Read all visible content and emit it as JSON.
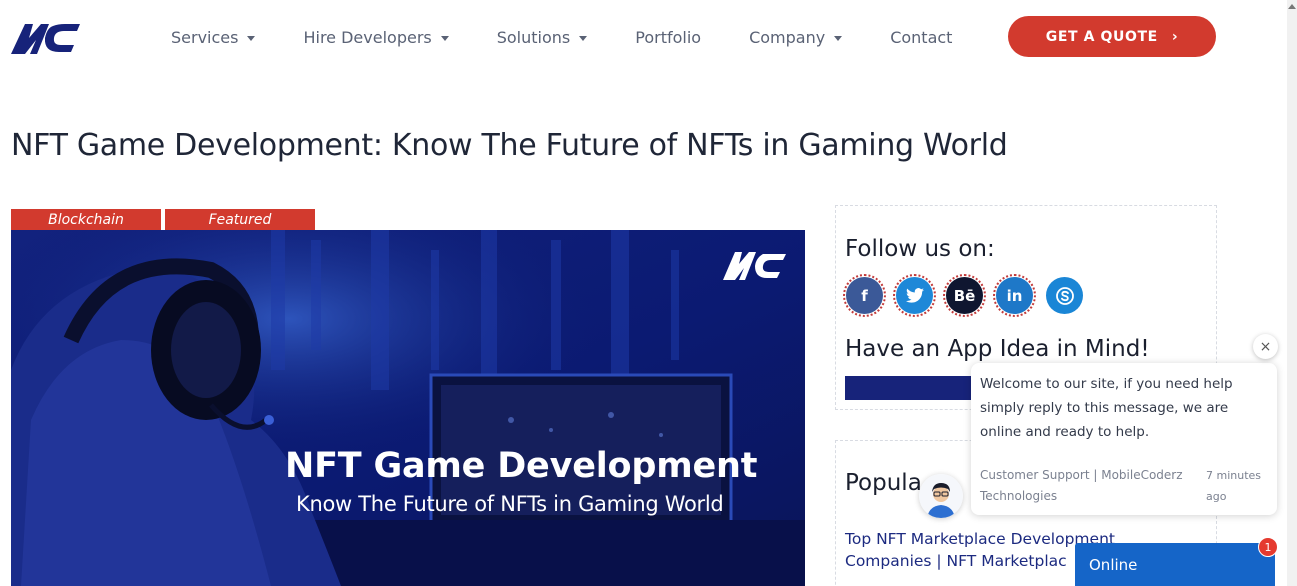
{
  "header": {
    "logo_text": "MC",
    "nav": [
      {
        "label": "Services",
        "dropdown": true
      },
      {
        "label": "Hire Developers",
        "dropdown": true
      },
      {
        "label": "Solutions",
        "dropdown": true
      },
      {
        "label": "Portfolio",
        "dropdown": false
      },
      {
        "label": "Company",
        "dropdown": true
      },
      {
        "label": "Contact",
        "dropdown": false
      }
    ],
    "cta_label": "GET A QUOTE",
    "cta_icon": "chevron-right-icon"
  },
  "article": {
    "title": "NFT Game Development: Know The Future of NFTs in Gaming World",
    "tags": [
      "Blockchain",
      "Featured"
    ],
    "hero": {
      "logo_text": "MC",
      "headline": "NFT Game Development",
      "subheadline": "Know The Future of NFTs in Gaming World"
    }
  },
  "sidebar": {
    "follow_title": "Follow us on:",
    "social": [
      {
        "name": "facebook-icon",
        "glyph": "f",
        "color": "#3b5998"
      },
      {
        "name": "twitter-icon",
        "glyph": "t",
        "color": "#1e88d8"
      },
      {
        "name": "behance-icon",
        "glyph": "Bē",
        "color": "#0f1630"
      },
      {
        "name": "linkedin-icon",
        "glyph": "in",
        "color": "#1e78c8"
      },
      {
        "name": "skype-icon",
        "glyph": "S",
        "color": "#1a86d6"
      }
    ],
    "app_idea_title": "Have an App Idea in Mind!",
    "popular_title": "Popula",
    "popular_post": "Top NFT Marketplace Development Companies | NFT Marketplac"
  },
  "chat": {
    "message": "Welcome to our site, if you need help simply reply to this message, we are online and ready to help.",
    "sender": "Customer Support | MobileCoderz Technologies",
    "time": "7 minutes ago",
    "close_label": "×",
    "status": "Online",
    "unread": "1"
  },
  "colors": {
    "accent": "#d23a2e",
    "navy": "#17237a",
    "chat_blue": "#1565c8"
  }
}
